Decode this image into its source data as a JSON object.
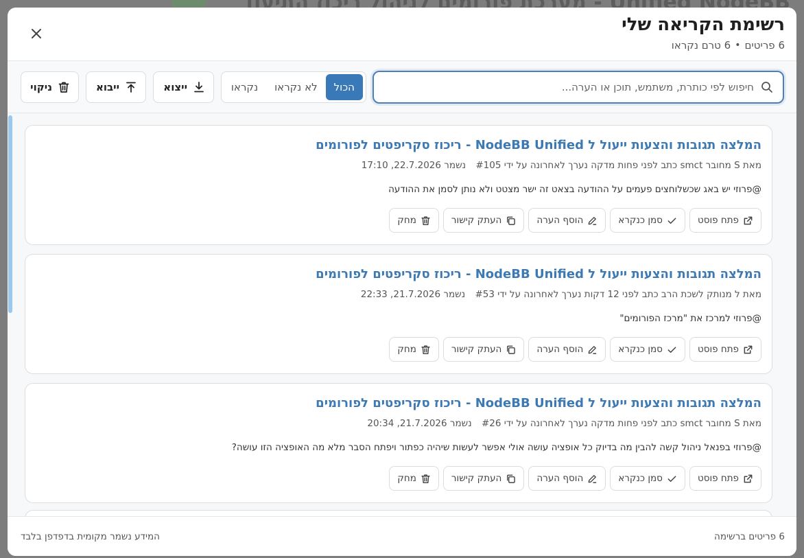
{
  "background": {
    "title": "Unified NodeBB - מערכת פורומים לניהול ריכוז התיעוד"
  },
  "modal": {
    "title": "רשימת הקריאה שלי",
    "subtitle_items": "6 פריטים",
    "subtitle_unread": "6 טרם נקראו",
    "close_icon": "close-icon"
  },
  "toolbar": {
    "search_placeholder": "חיפוש לפי כותרת, משתמש, תוכן או הערה...",
    "search_value": "",
    "filters": [
      {
        "label": "הכול",
        "active": true
      },
      {
        "label": "לא נקראו",
        "active": false
      },
      {
        "label": "נקראו",
        "active": false
      }
    ],
    "export_label": "ייצוא",
    "import_label": "ייבוא",
    "clear_label": "ניקוי"
  },
  "items": [
    {
      "title": "המלצה תגובות והצעות ייעול ל NodeBB Unified - ריכוז סקריפטים לפורומים",
      "meta": "מאת S מחובר smct כתב לפני פחות מדקה נערך לאחרונה על ידי #105",
      "saved": "נשמר 22.7.2026, 17:10",
      "excerpt": "@פרוזי יש באג שכשלוחצים פעמים על ההודעה בצאט זה ישר מצטט ולא נותן לסמן את ההודעה"
    },
    {
      "title": "המלצה תגובות והצעות ייעול ל NodeBB Unified - ריכוז סקריפטים לפורומים",
      "meta": "מאת ל מנותק לשכת הרב כתב לפני 12 דקות נערך לאחרונה על ידי #53",
      "saved": "נשמר 21.7.2026, 22:33",
      "excerpt": "@פרוזי למרכז את \"מרכז הפורומים\""
    },
    {
      "title": "המלצה תגובות והצעות ייעול ל NodeBB Unified - ריכוז סקריפטים לפורומים",
      "meta": "מאת S מחובר smct כתב לפני פחות מדקה נערך לאחרונה על ידי #26",
      "saved": "נשמר 21.7.2026, 20:34",
      "excerpt": "@פרוזי בפנאל ניהול קשה להבין מה בדיוק כל אופציה עושה אולי אפשר לעשות שיהיה כפתור ויפתח הסבר מלא מה האופציה הזו עושה?"
    }
  ],
  "actions": {
    "open_post": "פתח פוסט",
    "mark_read": "סמן כנקרא",
    "add_note": "הוסף הערה",
    "copy_link": "העתק קישור",
    "delete": "מחק"
  },
  "footer": {
    "count": "6 פריטים ברשימה",
    "note": "המידע נשמר מקומית בדפדפן בלבד"
  },
  "colors": {
    "accent": "#3a79b8",
    "link": "#3d79b3",
    "scroll_thumb": "#9cc8ee"
  }
}
